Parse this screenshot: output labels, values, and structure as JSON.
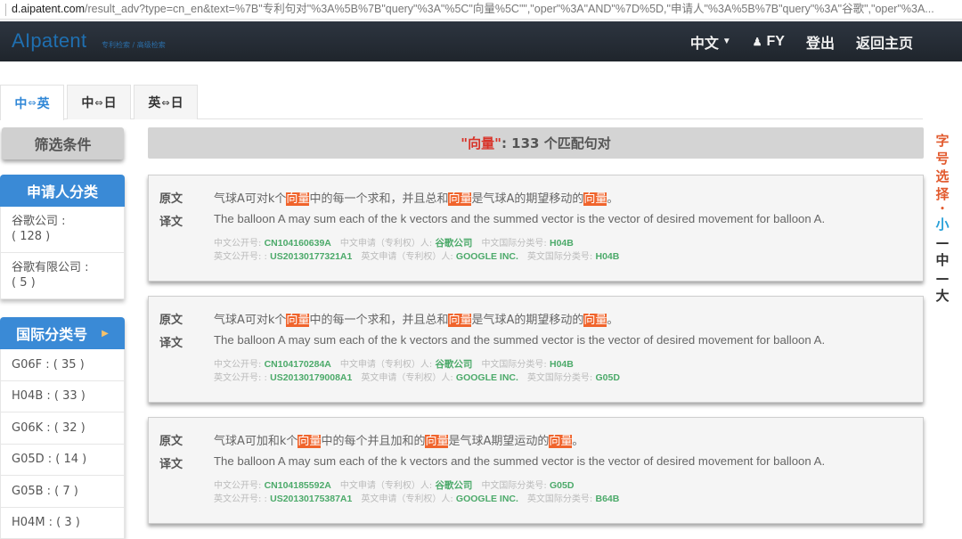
{
  "browser": {
    "url_host": "d.aipatent.com",
    "url_path": "/result_adv?type=cn_en&text=%7B\"专利句对\"%3A%5B%7B\"query\"%3A\"%5C\"向量%5C\"\",\"oper\"%3A\"AND\"%7D%5D,\"申请人\"%3A%5B%7B\"query\"%3A\"谷歌\",\"oper\"%3A..."
  },
  "navbar": {
    "brand": "AIpatent",
    "breadcrumb": "专利检索 / 高级检索",
    "language": "中文",
    "user": "FY",
    "logout": "登出",
    "home": "返回主页"
  },
  "tabs": [
    {
      "left": "中",
      "arrow": "⇔",
      "right": "英",
      "active": true
    },
    {
      "left": "中",
      "arrow": "⇔",
      "right": "日",
      "active": false
    },
    {
      "left": "英",
      "arrow": "⇔",
      "right": "日",
      "active": false
    }
  ],
  "sidebar": {
    "filter_title": "筛选条件",
    "applicant_panel": {
      "title": "申请人分类",
      "items": [
        {
          "name": "谷歌公司 :",
          "count": "( 128 )"
        },
        {
          "name": "谷歌有限公司 :",
          "count": "( 5 )"
        }
      ]
    },
    "ipc_panel": {
      "title": "国际分类号",
      "items": [
        "G06F : ( 35 )",
        "H04B : ( 33 )",
        "G06K : ( 32 )",
        "G05D : ( 14 )",
        "G05B : ( 7 )",
        "H04M : ( 3 )"
      ]
    }
  },
  "summary": {
    "keyword": "\"向量\"",
    "text": " : 133 个匹配句对"
  },
  "labels": {
    "original": "原文",
    "translation": "译文",
    "cn_pub": "中文公开号:",
    "cn_applicant": "中文申请（专利权）人:",
    "cn_ipc": "中文国际分类号:",
    "en_pub": "英文公开号: :",
    "en_applicant": "英文申请（专利权）人:",
    "en_ipc": "英文国际分类号:"
  },
  "results": [
    {
      "original": [
        {
          "t": "气球A可对k个",
          "h": false
        },
        {
          "t": "向量",
          "h": true
        },
        {
          "t": "中的每一个求和，并且总和",
          "h": false
        },
        {
          "t": "向量",
          "h": true
        },
        {
          "t": "是气球A的期望移动的",
          "h": false
        },
        {
          "t": "向量",
          "h": true
        },
        {
          "t": "。",
          "h": false
        }
      ],
      "translation": "The balloon A may sum each of the k vectors and the summed vector is the vector of desired movement for balloon A.",
      "cn_pub": "CN104160639A",
      "cn_applicant": "谷歌公司",
      "cn_ipc": "H04B",
      "en_pub": "US20130177321A1",
      "en_applicant": "GOOGLE INC.",
      "en_ipc": "H04B"
    },
    {
      "original": [
        {
          "t": "气球A可对k个",
          "h": false
        },
        {
          "t": "向量",
          "h": true
        },
        {
          "t": "中的每一个求和，并且总和",
          "h": false
        },
        {
          "t": "向量",
          "h": true
        },
        {
          "t": "是气球A的期望移动的",
          "h": false
        },
        {
          "t": "向量",
          "h": true
        },
        {
          "t": "。",
          "h": false
        }
      ],
      "translation": "The balloon A may sum each of the k vectors and the summed vector is the vector of desired movement for balloon A.",
      "cn_pub": "CN104170284A",
      "cn_applicant": "谷歌公司",
      "cn_ipc": "H04B",
      "en_pub": "US20130179008A1",
      "en_applicant": "GOOGLE INC.",
      "en_ipc": "G05D"
    },
    {
      "original": [
        {
          "t": "气球A可加和k个",
          "h": false
        },
        {
          "t": "向量",
          "h": true
        },
        {
          "t": "中的每个并且加和的",
          "h": false
        },
        {
          "t": "向量",
          "h": true
        },
        {
          "t": "是气球A期望运动的",
          "h": false
        },
        {
          "t": "向量",
          "h": true
        },
        {
          "t": "。",
          "h": false
        }
      ],
      "translation": "The balloon A may sum each of the k vectors and the summed vector is the vector of desired movement for balloon A.",
      "cn_pub": "CN104185592A",
      "cn_applicant": "谷歌公司",
      "cn_ipc": "G05D",
      "en_pub": "US20130175387A1",
      "en_applicant": "GOOGLE INC.",
      "en_ipc": "B64B"
    }
  ],
  "font_picker": {
    "title_chars": [
      "字",
      "号",
      "选",
      "择"
    ],
    "dot": "•",
    "small": "小",
    "medium": "中",
    "large": "大",
    "dash": "—",
    "active": "small"
  },
  "colors": {
    "brand_blue": "#3a8ad6",
    "highlight": "#f0642c",
    "meta_value": "#4caa6a",
    "keyword_red": "#d8342a"
  }
}
